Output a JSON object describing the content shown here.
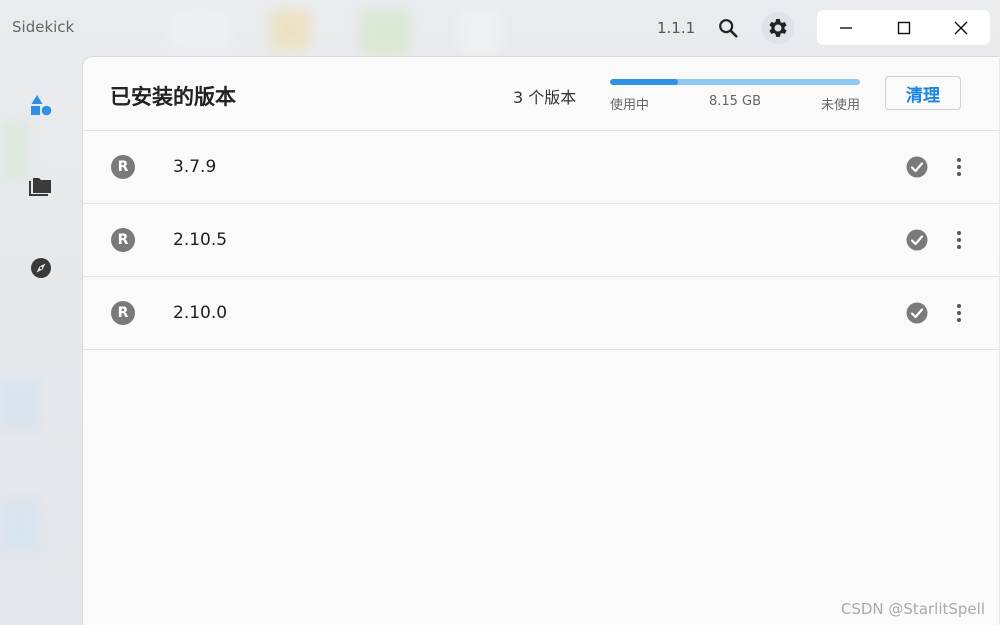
{
  "app": {
    "title": "Sidekick",
    "version": "1.1.1"
  },
  "icons": {
    "search": "search-icon",
    "settings": "gear-icon",
    "minimize": "minimize-icon",
    "maximize": "maximize-icon",
    "close": "close-icon",
    "sidebar": [
      "shapes-icon",
      "folder-icon",
      "compass-icon"
    ],
    "row_badge": "R",
    "check": "check-circle-icon",
    "more": "more-vertical-icon"
  },
  "header": {
    "title": "已安装的版本",
    "count": "3 个版本",
    "usage": {
      "used_label": "使用中",
      "size": "8.15 GB",
      "unused_label": "未使用",
      "used_fraction": 0.27
    },
    "clean_label": "清理"
  },
  "versions": [
    {
      "version": "3.7.9"
    },
    {
      "version": "2.10.5"
    },
    {
      "version": "2.10.0"
    }
  ],
  "watermark": "CSDN @StarlitSpell",
  "colors": {
    "accent": "#1a84e6",
    "bar_used": "#2d8fe6",
    "bar_free": "#8fc7f4",
    "badge": "#7a7a7a"
  }
}
